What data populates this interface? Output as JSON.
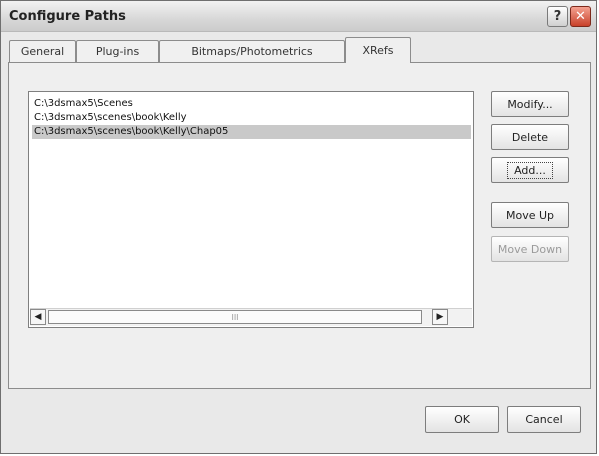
{
  "window": {
    "title": "Configure Paths",
    "help_label": "?",
    "close_label": "✕"
  },
  "tabs": [
    {
      "label": "General"
    },
    {
      "label": "Plug-ins"
    },
    {
      "label": "Bitmaps/Photometrics"
    },
    {
      "label": "XRefs"
    }
  ],
  "active_tab": "XRefs",
  "paths": [
    "C:\\3dsmax5\\Scenes",
    "C:\\3dsmax5\\scenes\\book\\Kelly",
    "C:\\3dsmax5\\scenes\\book\\Kelly\\Chap05"
  ],
  "selected_path_index": 2,
  "scrollbar": {
    "left_arrow": "◀",
    "right_arrow": "▶",
    "thumb_grip": "III"
  },
  "side_buttons": {
    "modify": "Modify...",
    "delete": "Delete",
    "add": "Add...",
    "move_up": "Move Up",
    "move_down": "Move Down"
  },
  "footer_buttons": {
    "ok": "OK",
    "cancel": "Cancel"
  }
}
